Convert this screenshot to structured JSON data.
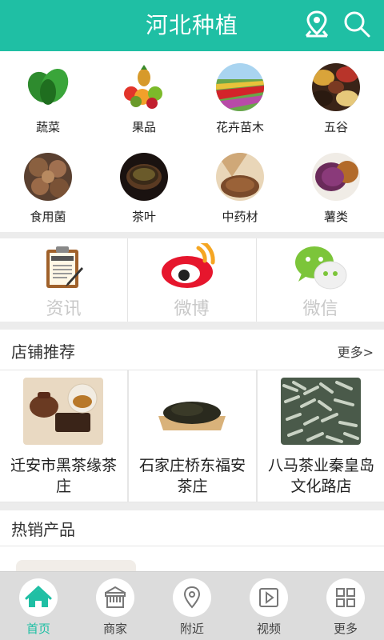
{
  "header": {
    "title": "河北种植",
    "location_icon": "location-pin-icon",
    "search_icon": "search-icon",
    "bg_color": "#1fbfa4"
  },
  "categories": [
    {
      "label": "蔬菜",
      "icon": "vegetables-image"
    },
    {
      "label": "果品",
      "icon": "fruits-image"
    },
    {
      "label": "花卉苗木",
      "icon": "flowers-image"
    },
    {
      "label": "五谷",
      "icon": "grains-image"
    },
    {
      "label": "食用菌",
      "icon": "mushrooms-image"
    },
    {
      "label": "茶叶",
      "icon": "tea-image"
    },
    {
      "label": "中药材",
      "icon": "herbs-image"
    },
    {
      "label": "薯类",
      "icon": "potatoes-image"
    }
  ],
  "social": [
    {
      "label": "资讯",
      "icon": "news-icon"
    },
    {
      "label": "微博",
      "icon": "weibo-icon"
    },
    {
      "label": "微信",
      "icon": "wechat-icon"
    }
  ],
  "shops": {
    "title": "店铺推荐",
    "more": "更多>",
    "items": [
      {
        "name": "迁安市黑茶缘茶庄"
      },
      {
        "name": "石家庄桥东福安茶庄"
      },
      {
        "name": "八马茶业秦皇岛文化路店"
      }
    ]
  },
  "hot": {
    "title": "热销产品"
  },
  "nav": {
    "items": [
      {
        "label": "首页",
        "icon": "home-icon",
        "active": true
      },
      {
        "label": "商家",
        "icon": "store-icon",
        "active": false
      },
      {
        "label": "附近",
        "icon": "nearby-pin-icon",
        "active": false
      },
      {
        "label": "视频",
        "icon": "video-icon",
        "active": false
      },
      {
        "label": "更多",
        "icon": "more-grid-icon",
        "active": false
      }
    ],
    "active_color": "#1fbfa4"
  }
}
